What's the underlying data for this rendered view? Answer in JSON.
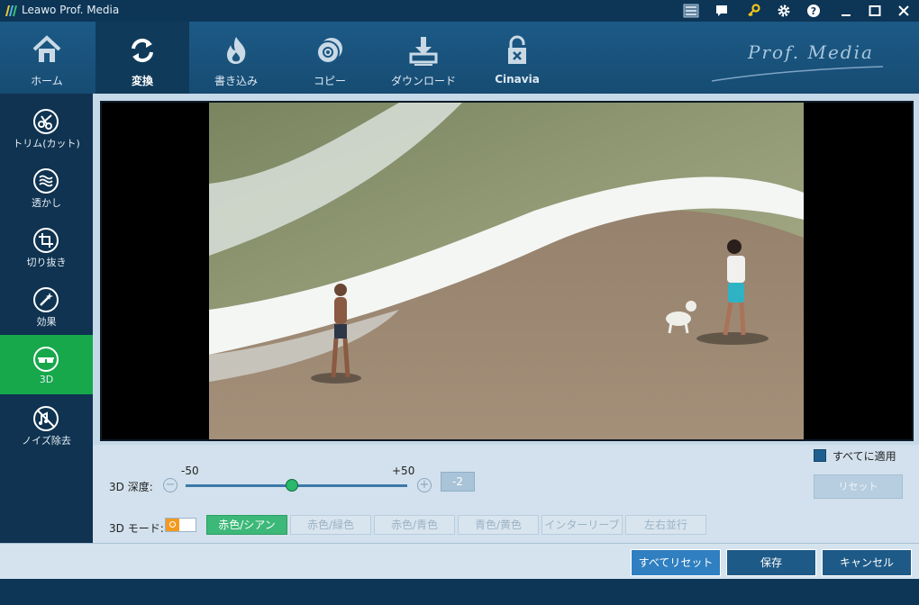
{
  "window": {
    "title": "Leawo Prof. Media"
  },
  "nav": {
    "items": [
      {
        "label": "ホーム",
        "icon": "home-icon"
      },
      {
        "label": "変換",
        "icon": "convert-icon"
      },
      {
        "label": "書き込み",
        "icon": "burn-icon"
      },
      {
        "label": "コピー",
        "icon": "copy-icon"
      },
      {
        "label": "ダウンロード",
        "icon": "download-icon"
      },
      {
        "label": "Cinavia",
        "icon": "cinavia-icon"
      }
    ],
    "active": "変換",
    "brand": "Prof. Media"
  },
  "sidebar": {
    "items": [
      {
        "label": "トリム(カット)",
        "icon": "scissors-icon"
      },
      {
        "label": "透かし",
        "icon": "watermark-icon"
      },
      {
        "label": "切り抜き",
        "icon": "crop-icon"
      },
      {
        "label": "効果",
        "icon": "effect-icon"
      },
      {
        "label": "3D",
        "icon": "3d-glasses-icon"
      },
      {
        "label": "ノイズ除去",
        "icon": "denoise-icon"
      }
    ],
    "active": "3D"
  },
  "controls": {
    "depth_label": "3D 深度:",
    "depth_min": "-50",
    "depth_max": "+50",
    "depth_value": "-2",
    "depth_level": -2,
    "mode_label": "3D モード:",
    "modes": [
      "赤色/シアン",
      "赤色/緑色",
      "赤色/青色",
      "青色/黄色",
      "インターリーブ",
      "左右並行"
    ],
    "active_mode": "赤色/シアン",
    "apply_all_label": "すべてに適用",
    "reset_label": "リセット"
  },
  "actions": {
    "reset_all": "すべてリセット",
    "save": "保存",
    "cancel": "キャンセル"
  },
  "colors": {
    "active_sidebar": "#16a84b",
    "active_mode": "#3cb878",
    "primary_button": "#2f7fc1",
    "dark_button": "#1e5a87"
  }
}
